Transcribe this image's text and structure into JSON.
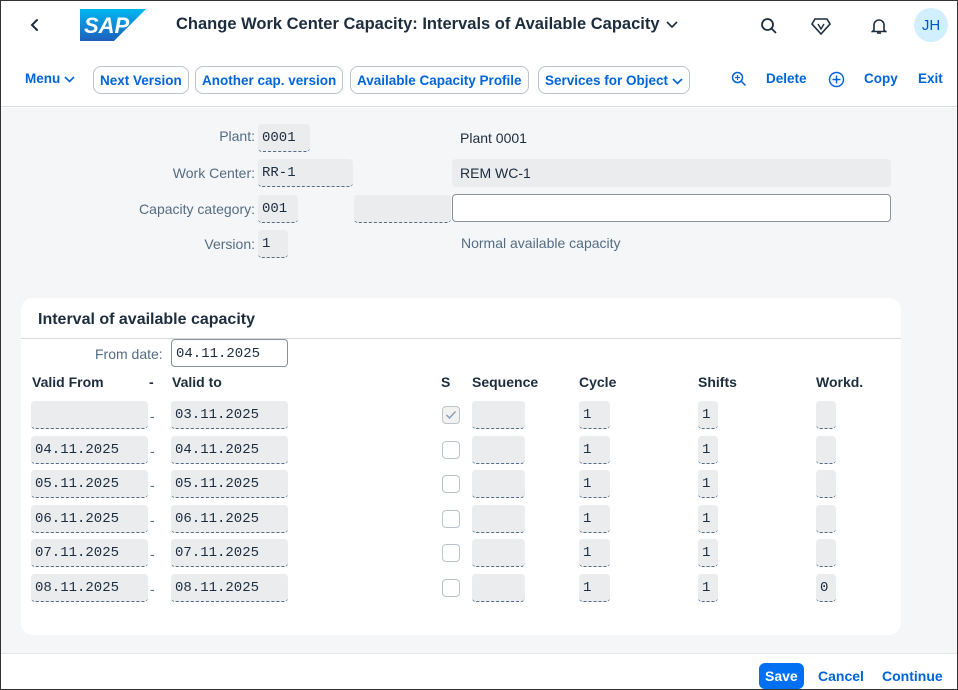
{
  "shell": {
    "title": "Change Work Center Capacity: Intervals of Available Capacity",
    "logo_text": "SAP",
    "avatar_initials": "JH"
  },
  "toolbar": {
    "menu": "Menu",
    "next_version": "Next Version",
    "another_cap_version": "Another cap. version",
    "available_capacity_profile": "Available Capacity Profile",
    "services_for_object": "Services for Object",
    "delete": "Delete",
    "copy": "Copy",
    "exit": "Exit"
  },
  "header": {
    "plant_label": "Plant:",
    "plant_value": "0001",
    "plant_desc": "Plant 0001",
    "work_center_label": "Work Center:",
    "work_center_value": "RR-1",
    "work_center_desc": "REM WC-1",
    "capacity_category_label": "Capacity category:",
    "capacity_category_value": "001",
    "capacity_category_extra": "",
    "capacity_category_desc": "",
    "version_label": "Version:",
    "version_value": "1",
    "version_desc": "Normal available capacity"
  },
  "interval": {
    "title": "Interval of available capacity",
    "from_date_label": "From date:",
    "from_date_value": "04.11.2025",
    "columns": {
      "valid_from": "Valid From",
      "dash": "-",
      "valid_to": "Valid to",
      "s": "S",
      "sequence": "Sequence",
      "cycle": "Cycle",
      "shifts": "Shifts",
      "workd": "Workd."
    },
    "rows": [
      {
        "valid_from": "",
        "valid_to": "03.11.2025",
        "s_checked": true,
        "sequence": "",
        "cycle": "1",
        "shifts": "1",
        "workd": ""
      },
      {
        "valid_from": "04.11.2025",
        "valid_to": "04.11.2025",
        "s_checked": false,
        "sequence": "",
        "cycle": "1",
        "shifts": "1",
        "workd": ""
      },
      {
        "valid_from": "05.11.2025",
        "valid_to": "05.11.2025",
        "s_checked": false,
        "sequence": "",
        "cycle": "1",
        "shifts": "1",
        "workd": ""
      },
      {
        "valid_from": "06.11.2025",
        "valid_to": "06.11.2025",
        "s_checked": false,
        "sequence": "",
        "cycle": "1",
        "shifts": "1",
        "workd": ""
      },
      {
        "valid_from": "07.11.2025",
        "valid_to": "07.11.2025",
        "s_checked": false,
        "sequence": "",
        "cycle": "1",
        "shifts": "1",
        "workd": ""
      },
      {
        "valid_from": "08.11.2025",
        "valid_to": "08.11.2025",
        "s_checked": false,
        "sequence": "",
        "cycle": "1",
        "shifts": "1",
        "workd": "0"
      }
    ]
  },
  "footer": {
    "save": "Save",
    "cancel": "Cancel",
    "continue": "Continue"
  }
}
